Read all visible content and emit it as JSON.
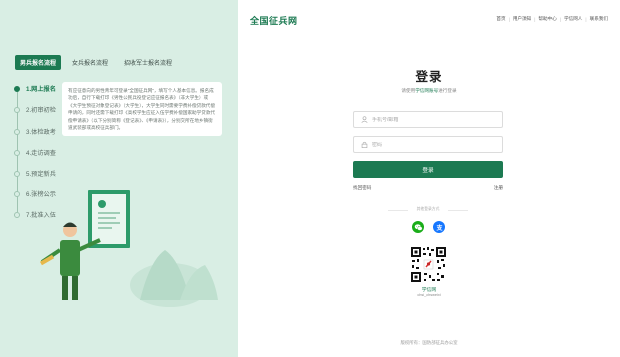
{
  "left_panel": {
    "tabs": [
      {
        "label": "男兵报名流程",
        "active": true
      },
      {
        "label": "女兵报名流程",
        "active": false
      },
      {
        "label": "招收军士报名流程",
        "active": false
      }
    ],
    "steps": [
      {
        "label": "1.网上报名",
        "active": true
      },
      {
        "label": "2.初审初检",
        "active": false
      },
      {
        "label": "3.体检政考",
        "active": false
      },
      {
        "label": "4.走访调查",
        "active": false
      },
      {
        "label": "5.预定新兵",
        "active": false
      },
      {
        "label": "6.张榜公示",
        "active": false
      },
      {
        "label": "7.批准入伍",
        "active": false
      }
    ],
    "description": "有应征意向的男性青年可登录\"全国征兵网\"，填写个人基本信息。报名成功后，自行下载打印《男性公民兵役登记应征报名表》（非大学生）或《大学生预征对象登记表》（大学生），大学生同时需要学费补偿贷款代偿申请的，同时还需下载打印《高校学生应征入伍学费补偿国家助学贷款代偿申请表》（以下分别简称《登记表》、《申请表》），分别交所在地乡镇街道武装部或高校征兵部门。"
  },
  "header": {
    "brand": "全国征兵网",
    "nav": [
      "首页",
      "用户須知",
      "帮助中心",
      "学信网人",
      "联系我们"
    ]
  },
  "login": {
    "title": "登录",
    "subtitle_prefix": "请使用",
    "subtitle_highlight": "学信网账号",
    "subtitle_suffix": "进行登录",
    "phone_placeholder": "手机号/邮箱",
    "password_placeholder": "密码",
    "button_label": "登录",
    "forgot_label": "找回密码",
    "register_label": "注册",
    "other_methods_label": "其他登录方式"
  },
  "qr": {
    "name": "学信网",
    "id": "chsi_chsweixi"
  },
  "footer": {
    "text": "版权所有：国防部征兵办公室"
  },
  "colors": {
    "brand_green": "#1c7a52",
    "left_bg": "#d9eee4",
    "wechat": "#1aad19",
    "alipay": "#1677ff"
  },
  "icons": [
    "user-icon",
    "lock-icon",
    "wechat-icon",
    "alipay-icon",
    "qr-code-icon"
  ]
}
